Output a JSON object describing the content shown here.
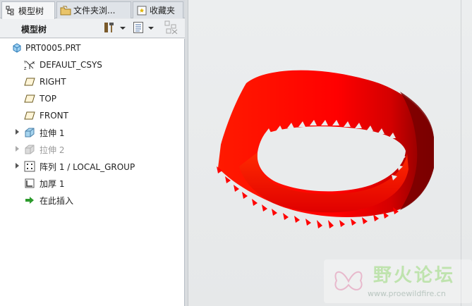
{
  "tabs": [
    {
      "label": "模型树",
      "icon": "model-tree-icon",
      "active": true
    },
    {
      "label": "文件夹浏...",
      "icon": "folder-browser-icon",
      "active": false
    },
    {
      "label": "收藏夹",
      "icon": "favorites-icon",
      "active": false
    }
  ],
  "toolbar": {
    "title": "模型树",
    "settings_icon": "tools-icon",
    "show_icon": "list-icon",
    "filter_icon": "tree-filter-icon"
  },
  "tree": {
    "root": "PRT0005.PRT",
    "items": [
      {
        "label": "DEFAULT_CSYS",
        "icon": "csys-icon",
        "expandable": false,
        "dimmed": false
      },
      {
        "label": "RIGHT",
        "icon": "datum-plane-icon",
        "expandable": false,
        "dimmed": false
      },
      {
        "label": "TOP",
        "icon": "datum-plane-icon",
        "expandable": false,
        "dimmed": false
      },
      {
        "label": "FRONT",
        "icon": "datum-plane-icon",
        "expandable": false,
        "dimmed": false
      },
      {
        "label": "拉伸 1",
        "icon": "extrude-icon",
        "expandable": true,
        "dimmed": false
      },
      {
        "label": "拉伸 2",
        "icon": "extrude-icon",
        "expandable": true,
        "dimmed": true
      },
      {
        "label": "阵列 1 / LOCAL_GROUP",
        "icon": "pattern-icon",
        "expandable": true,
        "dimmed": false
      },
      {
        "label": "加厚 1",
        "icon": "thicken-icon",
        "expandable": false,
        "dimmed": false
      },
      {
        "label": "在此插入",
        "icon": "insert-here-arrow-icon",
        "expandable": false,
        "dimmed": false
      }
    ]
  },
  "watermark": {
    "title": "野火论坛",
    "url": "www.proewildfire.cn"
  },
  "colors": {
    "model_red": "#ff0000",
    "model_dark": "#8a0000",
    "background": "#e8eaeb"
  }
}
